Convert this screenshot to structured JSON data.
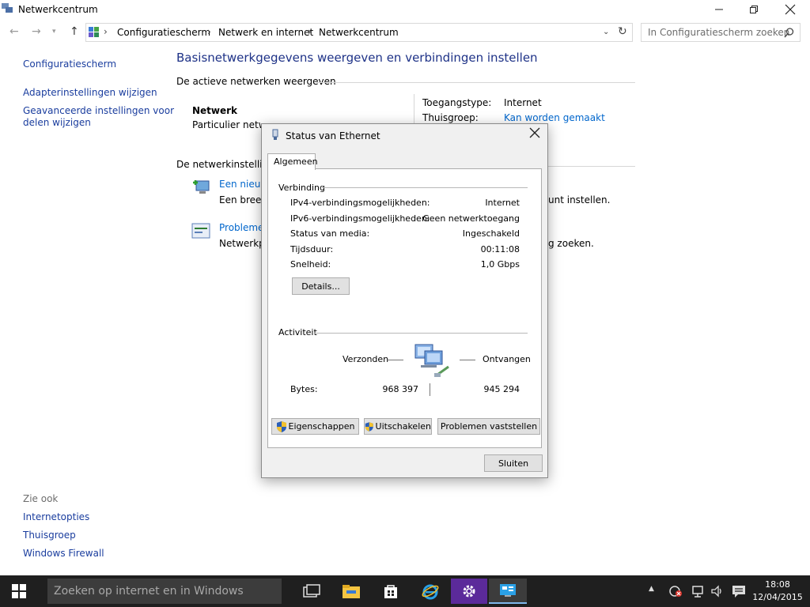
{
  "window": {
    "title": "Netwerkcentrum"
  },
  "address": {
    "breadcrumbs": [
      "Configuratiescherm",
      "Netwerk en internet",
      "Netwerkcentrum"
    ],
    "search_placeholder": "In Configuratiescherm zoeken"
  },
  "left_nav": {
    "home": "Configuratiescherm",
    "adapter": "Adapterinstellingen wijzigen",
    "advanced_line1": "Geavanceerde instellingen voor",
    "advanced_line2": "delen wijzigen",
    "see_also": "Zie ook",
    "links": [
      "Internetopties",
      "Thuisgroep",
      "Windows Firewall"
    ]
  },
  "main": {
    "heading": "Basisnetwerkgegevens weergeven en verbindingen instellen",
    "active_networks": "De actieve netwerken weergeven",
    "network_name": "Netwerk",
    "network_type": "Particulier netwerk",
    "access_type_label": "Toegangstype:",
    "access_type_value": "Internet",
    "homegroup_label": "Thuisgroep:",
    "homegroup_value": "Kan worden gemaakt",
    "change_settings": "De netwerkinstellingen wijzigen",
    "new_connection_link": "Een nieuwe verbinding of een nieuw netwerk instellen",
    "new_connection_desc": "Een breedband-, inbel- of VPN-verbinding of een router of toegangspunt instellen.",
    "troubleshoot_link": "Problemen oplossen",
    "troubleshoot_desc": "Netwerkproblemen vaststellen en herstellen of informatie over het oplossen van problemen zoeken."
  },
  "dialog": {
    "title": "Status van Ethernet",
    "tab": "Algemeen",
    "connection_group": "Verbinding",
    "rows": [
      {
        "label": "IPv4-verbindingsmogelijkheden:",
        "value": "Internet"
      },
      {
        "label": "IPv6-verbindingsmogelijkheden:",
        "value": "Geen netwerktoegang"
      },
      {
        "label": "Status van media:",
        "value": "Ingeschakeld"
      },
      {
        "label": "Tijdsduur:",
        "value": "00:11:08"
      },
      {
        "label": "Snelheid:",
        "value": "1,0 Gbps"
      }
    ],
    "details_button": "Details...",
    "activity_group": "Activiteit",
    "sent_label": "Verzonden",
    "received_label": "Ontvangen",
    "bytes_label": "Bytes:",
    "bytes_sent": "968 397",
    "bytes_received": "945 294",
    "properties_button": "Eigenschappen",
    "disable_button": "Uitschakelen",
    "diagnose_button": "Problemen vaststellen",
    "close_button": "Sluiten"
  },
  "taskbar": {
    "search_placeholder": "Zoeken op internet en in Windows",
    "time": "18:08",
    "date": "12/04/2015"
  },
  "colors": {
    "link": "#0066cc",
    "heading": "#1e3287",
    "taskbar": "#1f1f1f"
  }
}
